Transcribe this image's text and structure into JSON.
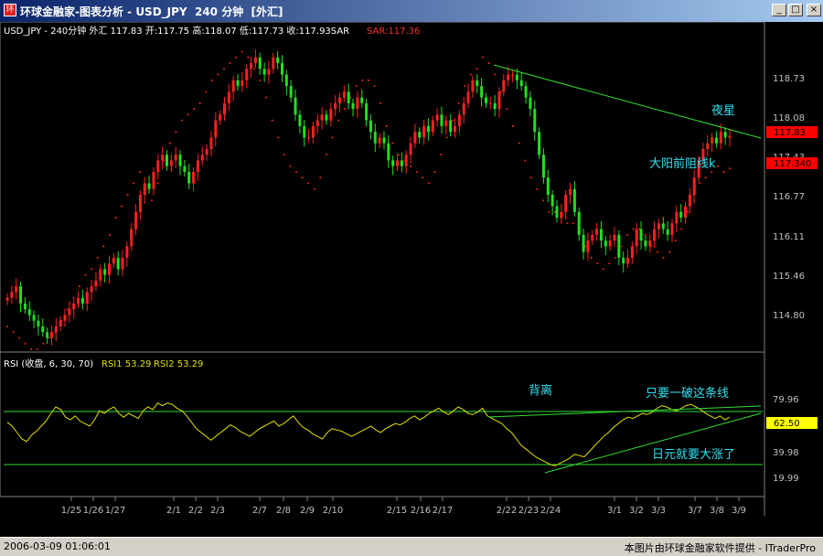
{
  "window": {
    "icon_glyph": "环",
    "title": "环球金融家-图表分析 - USD_JPY  240 分钟  [外汇]",
    "minimize_glyph": "_",
    "maximize_glyph": "□",
    "close_glyph": "×"
  },
  "price_panel": {
    "info_prefix": "USD_JPY - 240分钟 外汇  117.83 开:117.75 高:118.07 低:117.73 收:117.93SAR",
    "sar_value": "SAR:117.36",
    "axis_ticks": [
      "118.73",
      "118.08",
      "117.43",
      "116.77",
      "116.11",
      "115.46",
      "114.80"
    ],
    "current_price_tag": "117.83",
    "sar_price_tag": "117.340",
    "annotations": {
      "evening_star": "夜星",
      "resistance": "大阳前阻线k"
    }
  },
  "rsi_panel": {
    "info_prefix": "RSI (收盘, 6, 30, 70)",
    "rsi1": "RSI1 53.29",
    "rsi2": "RSI2 53.29",
    "axis_ticks": [
      "79.96",
      "39.98",
      "19.99"
    ],
    "current_tag": "62.50",
    "annotations": {
      "divergence": "背离",
      "break_line": "只要一破这条线",
      "yen_rise": "日元就要大涨了"
    }
  },
  "x_axis_labels": [
    "1/25",
    "1/26",
    "1/27",
    "2/1",
    "2/2",
    "2/3",
    "2/7",
    "2/8",
    "2/9",
    "2/10",
    "2/15",
    "2/16",
    "2/17",
    "2/22",
    "2/23",
    "2/24",
    "3/1",
    "3/2",
    "3/3",
    "3/7",
    "3/8",
    "3/9"
  ],
  "status": {
    "datetime": "2006-03-09  01:06:01",
    "credit": "本图片由环球金融家软件提供 - ITraderPro"
  },
  "colors": {
    "background": "#000000",
    "up_candle": "#ff2020",
    "down_candle": "#20e020",
    "sar_dots": "#ff2020",
    "rsi_line": "#e0e000",
    "trendline": "#33dd33",
    "annotation": "#30e0f0",
    "axis_text": "#c0c0c0",
    "price_tag": "#ff0000"
  },
  "chart_data": {
    "type": "candlestick",
    "symbol": "USD_JPY",
    "timeframe": "240分钟",
    "price_range": [
      114.2,
      119.6
    ],
    "close_path": [
      115.1,
      115.2,
      115.3,
      115.0,
      114.9,
      114.8,
      114.7,
      114.6,
      114.5,
      114.4,
      114.5,
      114.6,
      114.7,
      114.8,
      114.9,
      115.0,
      115.1,
      115.0,
      115.2,
      115.3,
      115.4,
      115.6,
      115.5,
      115.7,
      115.8,
      115.6,
      115.8,
      116.0,
      116.3,
      116.6,
      116.9,
      117.1,
      117.0,
      117.3,
      117.5,
      117.6,
      117.4,
      117.5,
      117.6,
      117.4,
      117.3,
      117.1,
      117.3,
      117.5,
      117.6,
      117.7,
      117.9,
      118.2,
      118.3,
      118.5,
      118.7,
      118.9,
      118.8,
      118.9,
      119.1,
      119.2,
      119.3,
      119.1,
      119.0,
      119.1,
      119.3,
      119.2,
      119.0,
      118.8,
      118.6,
      118.3,
      118.1,
      117.9,
      117.9,
      118.1,
      118.2,
      118.3,
      118.2,
      118.4,
      118.5,
      118.6,
      118.7,
      118.5,
      118.4,
      118.6,
      118.5,
      118.2,
      118.0,
      117.8,
      117.9,
      117.8,
      117.5,
      117.4,
      117.5,
      117.4,
      117.6,
      117.8,
      118.0,
      117.9,
      118.1,
      118.0,
      118.2,
      118.3,
      118.1,
      118.2,
      118.0,
      118.1,
      118.3,
      118.5,
      118.7,
      118.9,
      118.8,
      118.6,
      118.5,
      118.5,
      118.4,
      118.7,
      118.9,
      119.0,
      119.0,
      118.9,
      118.8,
      118.6,
      118.4,
      118.0,
      117.6,
      117.2,
      116.9,
      116.7,
      116.5,
      116.6,
      116.9,
      117.0,
      116.6,
      116.2,
      115.9,
      116.1,
      116.2,
      116.3,
      116.1,
      116.0,
      116.1,
      116.2,
      115.8,
      115.7,
      115.8,
      116.0,
      116.3,
      116.1,
      116.0,
      116.1,
      116.3,
      116.4,
      116.3,
      116.2,
      116.4,
      116.6,
      116.5,
      116.7,
      116.9,
      117.2,
      117.5,
      117.7,
      117.8,
      117.9,
      117.8,
      118.0,
      117.9,
      117.93
    ],
    "sar_path": [
      114.6,
      114.5,
      114.4,
      114.3,
      114.2,
      114.2,
      114.3,
      114.4,
      114.5,
      114.7,
      114.9,
      115.1,
      115.3,
      115.5,
      115.6,
      115.8,
      116.0,
      116.2,
      116.5,
      116.7,
      116.9,
      117.1,
      117.3,
      117.0,
      116.8,
      117.1,
      117.5,
      117.8,
      118.0,
      118.2,
      118.3,
      118.4,
      118.5,
      118.7,
      118.9,
      119.0,
      119.1,
      119.2,
      119.3,
      119.4,
      119.3,
      119.1,
      118.9,
      118.6,
      118.2,
      117.9,
      117.6,
      117.4,
      117.3,
      117.2,
      117.1,
      117.0,
      117.2,
      117.6,
      117.9,
      118.2,
      118.4,
      118.6,
      118.8,
      118.9,
      118.9,
      118.8,
      118.5,
      118.1,
      117.8,
      117.6,
      117.5,
      117.4,
      117.3,
      117.2,
      117.1,
      117.3,
      117.6,
      117.9,
      118.2,
      118.5,
      118.8,
      119.0,
      119.1,
      119.3,
      119.2,
      119.0,
      118.7,
      118.4,
      118.1,
      117.8,
      117.5,
      117.2,
      117.0,
      116.8,
      116.6,
      116.6,
      116.5,
      116.4,
      116.4,
      116.3,
      116.0,
      115.8,
      115.7,
      115.6,
      115.7,
      115.8,
      116.0,
      116.2,
      116.3,
      116.3,
      116.2,
      116.0,
      115.9,
      115.8,
      115.9,
      116.1,
      116.3,
      116.6,
      116.9,
      117.1,
      117.2,
      117.3,
      117.4,
      117.3,
      117.36
    ],
    "rsi_range": [
      10,
      100
    ],
    "rsi_path": [
      63,
      60,
      55,
      50,
      48,
      53,
      56,
      60,
      64,
      70,
      75,
      73,
      67,
      65,
      68,
      64,
      62,
      60,
      65,
      72,
      70,
      73,
      75,
      70,
      67,
      70,
      68,
      66,
      72,
      75,
      73,
      78,
      76,
      78,
      77,
      74,
      72,
      68,
      63,
      58,
      55,
      52,
      49,
      52,
      55,
      58,
      61,
      59,
      56,
      54,
      52,
      55,
      58,
      60,
      62,
      64,
      60,
      62,
      65,
      68,
      63,
      59,
      57,
      54,
      52,
      50,
      55,
      58,
      57,
      56,
      54,
      52,
      54,
      56,
      58,
      60,
      57,
      55,
      58,
      60,
      62,
      61,
      63,
      66,
      68,
      65,
      67,
      70,
      72,
      74,
      71,
      69,
      72,
      75,
      73,
      70,
      69,
      71,
      74,
      68,
      66,
      64,
      62,
      58,
      55,
      50,
      45,
      42,
      39,
      36,
      34,
      32,
      30,
      29,
      31,
      33,
      35,
      38,
      37,
      36,
      40,
      44,
      48,
      52,
      55,
      59,
      62,
      65,
      67,
      66,
      68,
      70,
      69,
      71,
      74,
      76,
      75,
      73,
      72,
      74,
      76,
      77,
      75,
      73,
      70,
      68,
      66,
      68,
      65,
      67
    ]
  }
}
